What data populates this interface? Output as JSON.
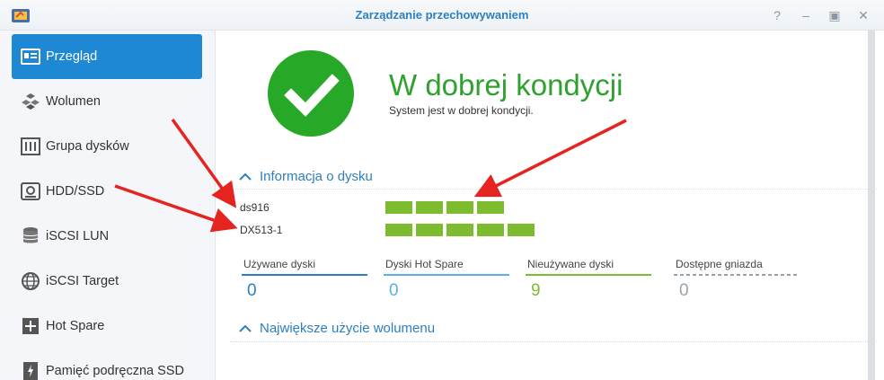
{
  "window": {
    "title": "Zarządzanie przechowywaniem"
  },
  "sidebar": {
    "items": [
      {
        "label": "Przegląd",
        "icon": "overview-icon"
      },
      {
        "label": "Wolumen",
        "icon": "cubes-icon"
      },
      {
        "label": "Grupa dysków",
        "icon": "disk-group-icon"
      },
      {
        "label": "HDD/SSD",
        "icon": "hdd-icon"
      },
      {
        "label": "iSCSI LUN",
        "icon": "database-icon"
      },
      {
        "label": "iSCSI Target",
        "icon": "globe-icon"
      },
      {
        "label": "Hot Spare",
        "icon": "plus-box-icon"
      },
      {
        "label": "Pamięć podręczna SSD",
        "icon": "flash-card-icon"
      }
    ]
  },
  "status": {
    "title": "W dobrej kondycji",
    "subtitle": "System jest w dobrej kondycji."
  },
  "disk_info": {
    "header": "Informacja o dysku",
    "devices": [
      {
        "name": "ds916",
        "disks": 4
      },
      {
        "name": "DX513-1",
        "disks": 5
      }
    ]
  },
  "stats": [
    {
      "label": "Używane dyski",
      "value": "0",
      "color": "#2d7fbf"
    },
    {
      "label": "Dyski Hot Spare",
      "value": "0",
      "color": "#58b0e6"
    },
    {
      "label": "Nieużywane dyski",
      "value": "9",
      "color": "#7dbb2f"
    },
    {
      "label": "Dostępne gniazda",
      "value": "0",
      "color": "#9aa2a9"
    }
  ],
  "volume_usage": {
    "header": "Największe użycie wolumenu"
  },
  "colors": {
    "accent": "#1e88d4",
    "ok": "#28a828",
    "disk": "#7dbb2f",
    "arrow": "#e52420"
  }
}
